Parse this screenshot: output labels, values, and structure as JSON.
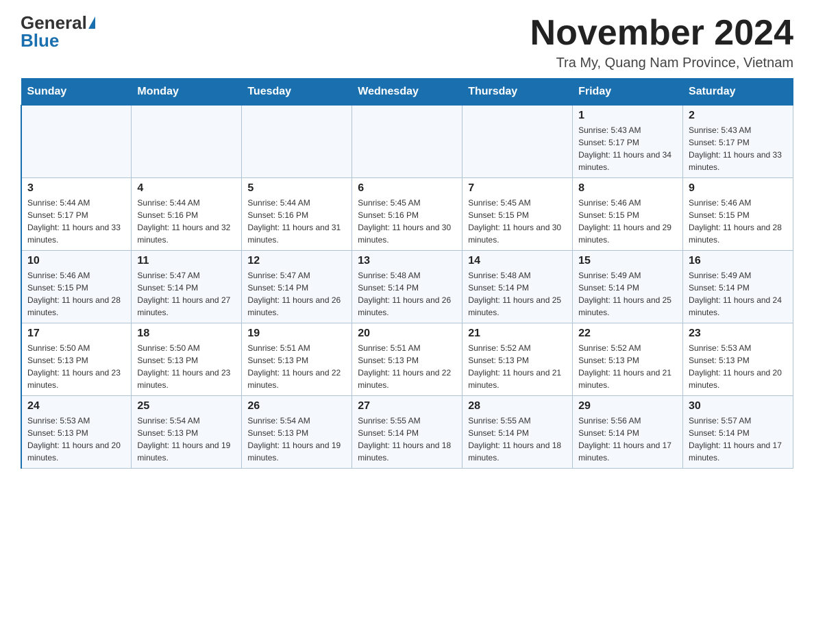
{
  "header": {
    "logo_general": "General",
    "logo_blue": "Blue",
    "month_title": "November 2024",
    "location": "Tra My, Quang Nam Province, Vietnam"
  },
  "weekdays": [
    "Sunday",
    "Monday",
    "Tuesday",
    "Wednesday",
    "Thursday",
    "Friday",
    "Saturday"
  ],
  "weeks": [
    [
      {
        "day": "",
        "sunrise": "",
        "sunset": "",
        "daylight": ""
      },
      {
        "day": "",
        "sunrise": "",
        "sunset": "",
        "daylight": ""
      },
      {
        "day": "",
        "sunrise": "",
        "sunset": "",
        "daylight": ""
      },
      {
        "day": "",
        "sunrise": "",
        "sunset": "",
        "daylight": ""
      },
      {
        "day": "",
        "sunrise": "",
        "sunset": "",
        "daylight": ""
      },
      {
        "day": "1",
        "sunrise": "Sunrise: 5:43 AM",
        "sunset": "Sunset: 5:17 PM",
        "daylight": "Daylight: 11 hours and 34 minutes."
      },
      {
        "day": "2",
        "sunrise": "Sunrise: 5:43 AM",
        "sunset": "Sunset: 5:17 PM",
        "daylight": "Daylight: 11 hours and 33 minutes."
      }
    ],
    [
      {
        "day": "3",
        "sunrise": "Sunrise: 5:44 AM",
        "sunset": "Sunset: 5:17 PM",
        "daylight": "Daylight: 11 hours and 33 minutes."
      },
      {
        "day": "4",
        "sunrise": "Sunrise: 5:44 AM",
        "sunset": "Sunset: 5:16 PM",
        "daylight": "Daylight: 11 hours and 32 minutes."
      },
      {
        "day": "5",
        "sunrise": "Sunrise: 5:44 AM",
        "sunset": "Sunset: 5:16 PM",
        "daylight": "Daylight: 11 hours and 31 minutes."
      },
      {
        "day": "6",
        "sunrise": "Sunrise: 5:45 AM",
        "sunset": "Sunset: 5:16 PM",
        "daylight": "Daylight: 11 hours and 30 minutes."
      },
      {
        "day": "7",
        "sunrise": "Sunrise: 5:45 AM",
        "sunset": "Sunset: 5:15 PM",
        "daylight": "Daylight: 11 hours and 30 minutes."
      },
      {
        "day": "8",
        "sunrise": "Sunrise: 5:46 AM",
        "sunset": "Sunset: 5:15 PM",
        "daylight": "Daylight: 11 hours and 29 minutes."
      },
      {
        "day": "9",
        "sunrise": "Sunrise: 5:46 AM",
        "sunset": "Sunset: 5:15 PM",
        "daylight": "Daylight: 11 hours and 28 minutes."
      }
    ],
    [
      {
        "day": "10",
        "sunrise": "Sunrise: 5:46 AM",
        "sunset": "Sunset: 5:15 PM",
        "daylight": "Daylight: 11 hours and 28 minutes."
      },
      {
        "day": "11",
        "sunrise": "Sunrise: 5:47 AM",
        "sunset": "Sunset: 5:14 PM",
        "daylight": "Daylight: 11 hours and 27 minutes."
      },
      {
        "day": "12",
        "sunrise": "Sunrise: 5:47 AM",
        "sunset": "Sunset: 5:14 PM",
        "daylight": "Daylight: 11 hours and 26 minutes."
      },
      {
        "day": "13",
        "sunrise": "Sunrise: 5:48 AM",
        "sunset": "Sunset: 5:14 PM",
        "daylight": "Daylight: 11 hours and 26 minutes."
      },
      {
        "day": "14",
        "sunrise": "Sunrise: 5:48 AM",
        "sunset": "Sunset: 5:14 PM",
        "daylight": "Daylight: 11 hours and 25 minutes."
      },
      {
        "day": "15",
        "sunrise": "Sunrise: 5:49 AM",
        "sunset": "Sunset: 5:14 PM",
        "daylight": "Daylight: 11 hours and 25 minutes."
      },
      {
        "day": "16",
        "sunrise": "Sunrise: 5:49 AM",
        "sunset": "Sunset: 5:14 PM",
        "daylight": "Daylight: 11 hours and 24 minutes."
      }
    ],
    [
      {
        "day": "17",
        "sunrise": "Sunrise: 5:50 AM",
        "sunset": "Sunset: 5:13 PM",
        "daylight": "Daylight: 11 hours and 23 minutes."
      },
      {
        "day": "18",
        "sunrise": "Sunrise: 5:50 AM",
        "sunset": "Sunset: 5:13 PM",
        "daylight": "Daylight: 11 hours and 23 minutes."
      },
      {
        "day": "19",
        "sunrise": "Sunrise: 5:51 AM",
        "sunset": "Sunset: 5:13 PM",
        "daylight": "Daylight: 11 hours and 22 minutes."
      },
      {
        "day": "20",
        "sunrise": "Sunrise: 5:51 AM",
        "sunset": "Sunset: 5:13 PM",
        "daylight": "Daylight: 11 hours and 22 minutes."
      },
      {
        "day": "21",
        "sunrise": "Sunrise: 5:52 AM",
        "sunset": "Sunset: 5:13 PM",
        "daylight": "Daylight: 11 hours and 21 minutes."
      },
      {
        "day": "22",
        "sunrise": "Sunrise: 5:52 AM",
        "sunset": "Sunset: 5:13 PM",
        "daylight": "Daylight: 11 hours and 21 minutes."
      },
      {
        "day": "23",
        "sunrise": "Sunrise: 5:53 AM",
        "sunset": "Sunset: 5:13 PM",
        "daylight": "Daylight: 11 hours and 20 minutes."
      }
    ],
    [
      {
        "day": "24",
        "sunrise": "Sunrise: 5:53 AM",
        "sunset": "Sunset: 5:13 PM",
        "daylight": "Daylight: 11 hours and 20 minutes."
      },
      {
        "day": "25",
        "sunrise": "Sunrise: 5:54 AM",
        "sunset": "Sunset: 5:13 PM",
        "daylight": "Daylight: 11 hours and 19 minutes."
      },
      {
        "day": "26",
        "sunrise": "Sunrise: 5:54 AM",
        "sunset": "Sunset: 5:13 PM",
        "daylight": "Daylight: 11 hours and 19 minutes."
      },
      {
        "day": "27",
        "sunrise": "Sunrise: 5:55 AM",
        "sunset": "Sunset: 5:14 PM",
        "daylight": "Daylight: 11 hours and 18 minutes."
      },
      {
        "day": "28",
        "sunrise": "Sunrise: 5:55 AM",
        "sunset": "Sunset: 5:14 PM",
        "daylight": "Daylight: 11 hours and 18 minutes."
      },
      {
        "day": "29",
        "sunrise": "Sunrise: 5:56 AM",
        "sunset": "Sunset: 5:14 PM",
        "daylight": "Daylight: 11 hours and 17 minutes."
      },
      {
        "day": "30",
        "sunrise": "Sunrise: 5:57 AM",
        "sunset": "Sunset: 5:14 PM",
        "daylight": "Daylight: 11 hours and 17 minutes."
      }
    ]
  ]
}
